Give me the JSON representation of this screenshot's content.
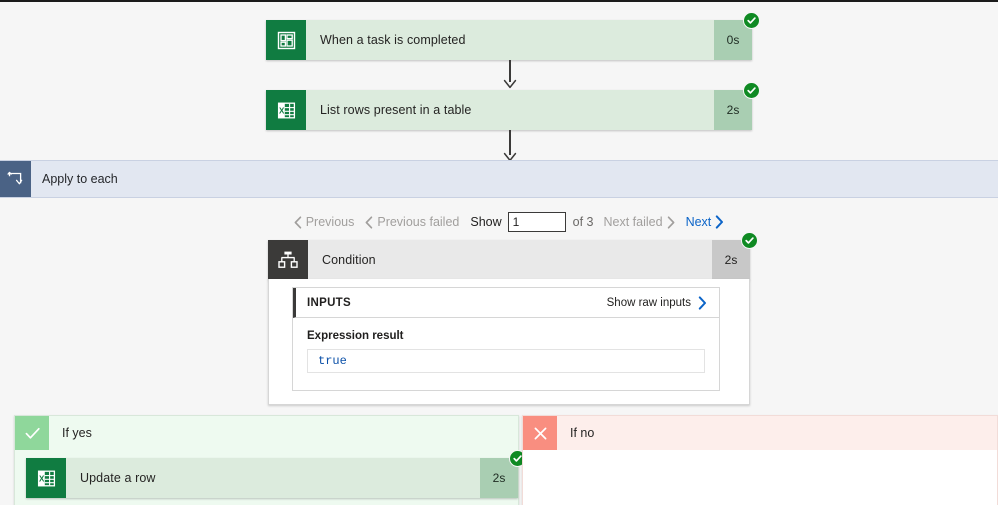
{
  "flow": {
    "steps": [
      {
        "id": "trigger",
        "name": "When a task is completed",
        "duration": "0s",
        "icon": "planner-icon",
        "status": "succeeded"
      },
      {
        "id": "list-rows",
        "name": "List rows present in a table",
        "duration": "2s",
        "icon": "excel-icon",
        "status": "succeeded"
      }
    ],
    "loop": {
      "label": "Apply to each",
      "icon": "loop-icon"
    },
    "pager": {
      "previous": "Previous",
      "previous_failed": "Previous failed",
      "show_label": "Show",
      "page_value": "1",
      "page_placeholder": "1",
      "of_label": "of 3",
      "total_pages": 3,
      "next_failed": "Next failed",
      "next": "Next",
      "next_enabled": true
    },
    "condition": {
      "name": "Condition",
      "duration": "2s",
      "icon": "condition-icon",
      "status": "succeeded",
      "inputs": {
        "header": "INPUTS",
        "raw_link": "Show raw inputs",
        "field_label": "Expression result",
        "field_value": "true"
      }
    },
    "branches": {
      "yes": {
        "label": "If yes",
        "icon": "check-icon",
        "actions": [
          {
            "id": "update-row",
            "name": "Update a row",
            "duration": "2s",
            "icon": "excel-icon",
            "status": "succeeded"
          }
        ]
      },
      "no": {
        "label": "If no",
        "icon": "cross-icon",
        "actions": []
      }
    }
  },
  "colors": {
    "success_green": "#0f8a23",
    "card_green": "#dcebdd",
    "duration_green": "#a9ceb2",
    "excel_green": "#107c41",
    "loop_blue": "#4a6285",
    "loop_bar": "#e2e7f1",
    "link_blue": "#0b64c8",
    "value_blue": "#0b50a8",
    "yes_green": "#8fd79b",
    "no_red": "#f98e80",
    "condition_gray": "#3b3a39"
  }
}
